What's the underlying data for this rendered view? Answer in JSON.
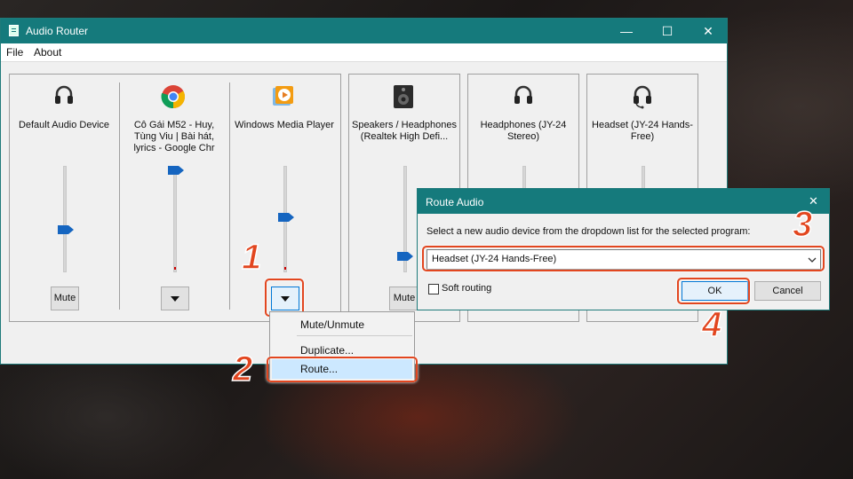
{
  "window": {
    "title": "Audio Router",
    "minimize": "—",
    "maximize": "☐",
    "close": "✕"
  },
  "menu": {
    "file": "File",
    "about": "About"
  },
  "programs": [
    {
      "label": "Default Audio Device",
      "icon": "headphones-icon",
      "button": "Mute",
      "level": 0.45
    },
    {
      "label": "Cô Gái M52 - Huy, Tùng Viu | Bài hát, lyrics - Google Chr",
      "icon": "chrome-icon",
      "button": "",
      "level": 1.0
    },
    {
      "label": "Windows Media Player",
      "icon": "windows-media-player-icon",
      "button": "",
      "level": 0.5
    }
  ],
  "devices": [
    {
      "label": "Speakers / Headphones (Realtek High Defi...",
      "icon": "speaker-icon",
      "button": "Mute",
      "level": 0.13
    },
    {
      "label": "Headphones (JY-24 Stereo)",
      "icon": "headphones-icon"
    },
    {
      "label": "Headset (JY-24 Hands-Free)",
      "icon": "headset-icon"
    }
  ],
  "context_menu": {
    "items": [
      "Mute/Unmute",
      "Duplicate...",
      "Route..."
    ],
    "highlighted": "Route..."
  },
  "dialog": {
    "title": "Route Audio",
    "close": "✕",
    "instruction": "Select a new audio device from the dropdown list for the selected program:",
    "selected_device": "Headset (JY-24 Hands-Free)",
    "soft_routing_label": "Soft routing",
    "soft_routing_checked": false,
    "ok": "OK",
    "cancel": "Cancel"
  },
  "steps": [
    "1",
    "2",
    "3",
    "4"
  ],
  "colors": {
    "titlebar": "#157a7c",
    "highlight": "#e2461f",
    "selection": "#cce8ff"
  }
}
